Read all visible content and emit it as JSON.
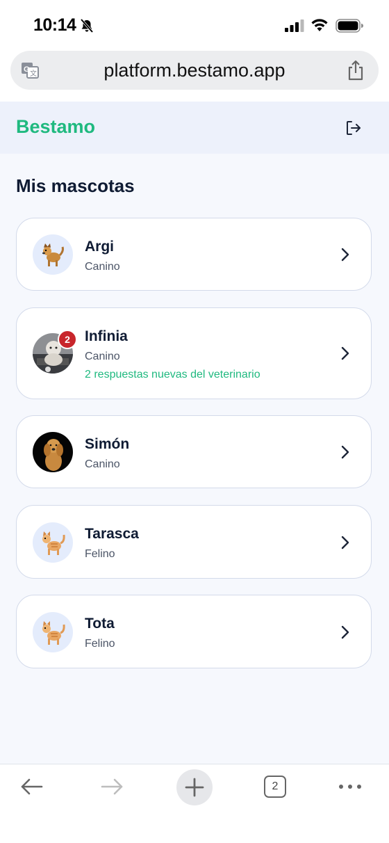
{
  "status_bar": {
    "time": "10:14"
  },
  "browser": {
    "url": "platform.bestamo.app",
    "tab_count": "2"
  },
  "app": {
    "brand": "Bestamo",
    "heading": "Mis mascotas"
  },
  "pets": [
    {
      "name": "Argi",
      "type": "Canino",
      "avatar": "dog-emoji"
    },
    {
      "name": "Infinia",
      "type": "Canino",
      "avatar": "photo",
      "badge": "2",
      "note": "2 respuestas nuevas del veterinario"
    },
    {
      "name": "Simón",
      "type": "Canino",
      "avatar": "photo"
    },
    {
      "name": "Tarasca",
      "type": "Felino",
      "avatar": "cat-emoji"
    },
    {
      "name": "Tota",
      "type": "Felino",
      "avatar": "cat-emoji"
    }
  ],
  "colors": {
    "brand": "#1fb97f",
    "badge": "#c8262c",
    "card_border": "#d3daea",
    "header_bg": "#edf1fb"
  }
}
